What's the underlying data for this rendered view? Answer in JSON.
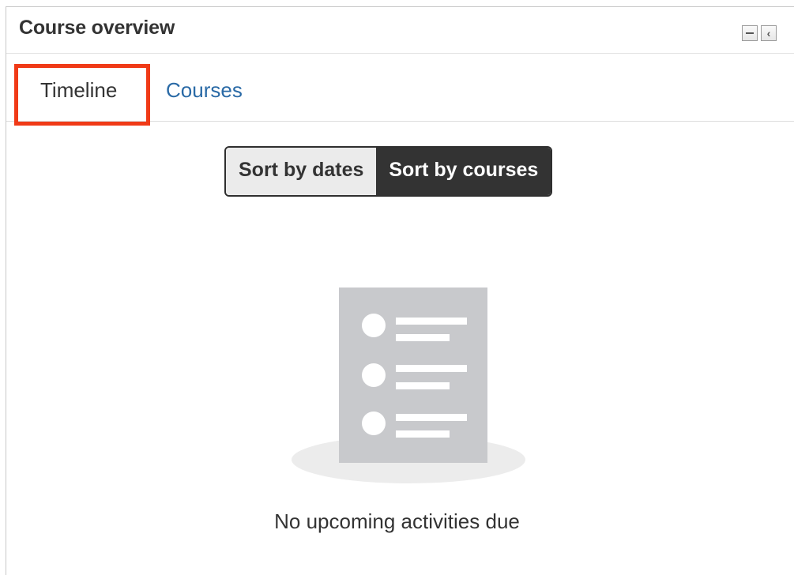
{
  "block": {
    "title": "Course overview",
    "controls": {
      "minimize_icon": "minus-box-icon",
      "dock_icon": "chevron-left-box-icon"
    }
  },
  "tabs": [
    {
      "label": "Timeline",
      "active": true,
      "highlighted": true
    },
    {
      "label": "Courses",
      "active": false
    }
  ],
  "sort_toggle": {
    "options": [
      {
        "label": "Sort by dates",
        "selected": false
      },
      {
        "label": "Sort by courses",
        "selected": true
      }
    ]
  },
  "empty_state": {
    "icon": "document-list-icon",
    "message": "No upcoming activities due"
  },
  "colors": {
    "link": "#2a6aa6",
    "highlight": "#f03a17",
    "selected_toggle_bg": "#333333",
    "illustration_gray": "#c8c9cc"
  }
}
